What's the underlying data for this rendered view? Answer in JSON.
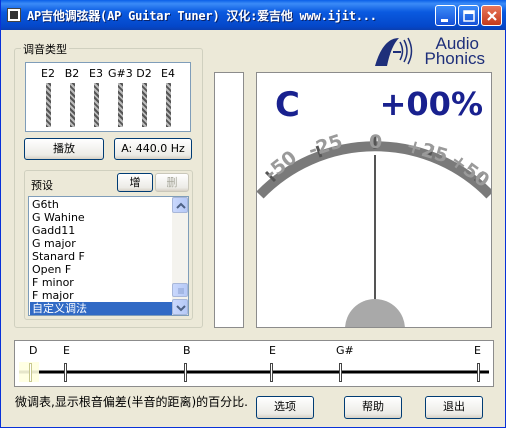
{
  "window": {
    "title": "AP吉他调弦器(AP Guitar Tuner) 汉化:爱吉他 www.ijit...",
    "controls": [
      "minimize-icon",
      "maximize-icon",
      "close-icon"
    ]
  },
  "tuning_group": {
    "legend": "调音类型",
    "strings": [
      "E2",
      "B2",
      "E3",
      "G#3",
      "D2",
      "E4"
    ],
    "play_button": "播放",
    "pitch_button": "A: 440.0 Hz"
  },
  "presets": {
    "legend": "预设",
    "add_button": "增",
    "delete_button": "删",
    "items": [
      "G6th",
      "G Wahine",
      "Gadd11",
      "G major",
      "Stanard F",
      "Open F",
      "F minor",
      "F major",
      "自定义调法"
    ],
    "selected_index": 8
  },
  "logo": {
    "line1": "Audio",
    "line2": "Phonics"
  },
  "meter": {
    "note": "C",
    "cents": "+00%",
    "scale_labels": [
      "-50",
      "-25",
      "0",
      "+25",
      "+50"
    ],
    "needle_cents": 0
  },
  "fretboard": {
    "notes": [
      "D",
      "E",
      "B",
      "E",
      "G#",
      "E"
    ]
  },
  "status_text": "微调表,显示根音偏差(半音的距离)的百分比.",
  "buttons": {
    "options": "选项",
    "help": "帮助",
    "exit": "退出"
  },
  "colors": {
    "title_bar": "#0a56dd",
    "accent_blue": "#19218f",
    "selection": "#316ac5"
  }
}
